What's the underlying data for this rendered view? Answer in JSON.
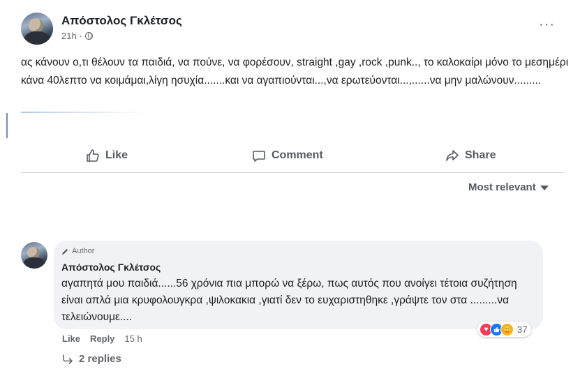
{
  "post": {
    "author": "Απόστολος Γκλέτσος",
    "time": "21h ·",
    "more_label": "···",
    "text": "ας κάνουν ο,τι θέλουν τα παιδιά,  να πούνε, να φορέσουν,  straight ,gay  ,rock ,punk..,  το καλοκαίρι μόνο το μεσημέρι κάνα 40λεπτο να κοιμάμαι,λίγη ησυχία.......και να  αγαπιούνται...,να ερωτεύονται...,......να μην μαλώνουν.........",
    "actions": {
      "like": "Like",
      "comment": "Comment",
      "share": "Share"
    },
    "sort_label": "Most relevant"
  },
  "comment": {
    "badge": "Author",
    "author": "Απόστολος Γκλέτσος",
    "text": "αγαπητά μου παιδιά......56 χρόνια πια μπορώ να ξέρω, πως αυτός που ανοίγει τέτοια συζήτηση είναι απλά μια κρυφολουγκρα ,ψιλοκακια ,γιατί δεν το ευχαριστηθηκε ,γράψτε τον στα .........να τελειώνουμε....",
    "reactions": {
      "icons": [
        "love-icon",
        "like-icon",
        "care-icon"
      ],
      "count": "37"
    },
    "like_label": "Like",
    "reply_label": "Reply",
    "time": "15 h",
    "replies_label": "2 replies"
  }
}
